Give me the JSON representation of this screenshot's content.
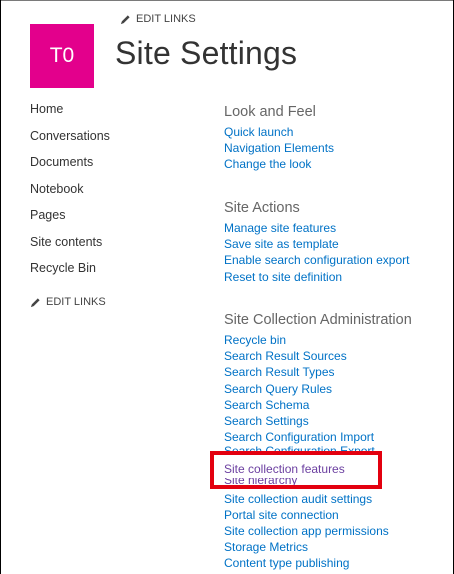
{
  "header": {
    "logo_text": "T0",
    "edit_links": "EDIT LINKS",
    "title": "Site Settings"
  },
  "nav": {
    "items": [
      "Home",
      "Conversations",
      "Documents",
      "Notebook",
      "Pages",
      "Site contents",
      "Recycle Bin"
    ],
    "edit_links": "EDIT LINKS"
  },
  "settings": {
    "look_and_feel": {
      "heading": "Look and Feel",
      "links": [
        "Quick launch",
        "Navigation Elements",
        "Change the look"
      ]
    },
    "site_actions": {
      "heading": "Site Actions",
      "links": [
        "Manage site features",
        "Save site as template",
        "Enable search configuration export",
        "Reset to site definition"
      ]
    },
    "site_collection_admin": {
      "heading": "Site Collection Administration",
      "links": [
        "Recycle bin",
        "Search Result Sources",
        "Search Result Types",
        "Search Query Rules",
        "Search Schema",
        "Search Settings",
        "Search Configuration Import",
        "Search Configuration Export",
        "Site collection features",
        "Site hierarchy",
        "Site collection audit settings",
        "Portal site connection",
        "Site collection app permissions",
        "Storage Metrics",
        "Content type publishing"
      ]
    }
  },
  "colors": {
    "logo_bg": "#e3008c",
    "link": "#0072c6",
    "visited_link": "#6b3fa0",
    "highlight": "#e3000f"
  }
}
